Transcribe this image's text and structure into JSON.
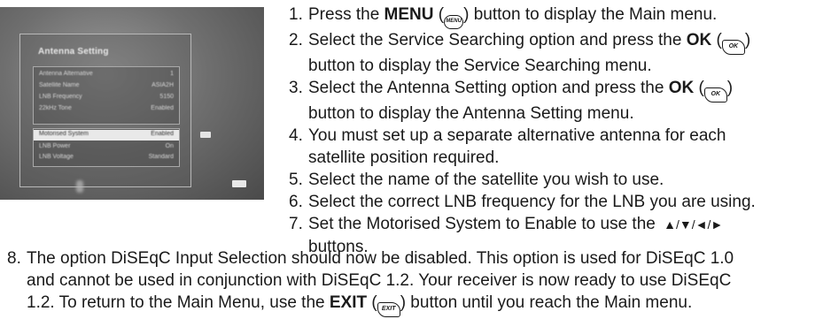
{
  "tv_screen": {
    "title": "Antenna Setting",
    "rows_top": [
      {
        "label": "Antenna Alternative",
        "value": "1"
      },
      {
        "label": "Satellite Name",
        "value": "ASIA2H"
      },
      {
        "label": "LNB Frequency",
        "value": "5150"
      },
      {
        "label": "22kHz Tone",
        "value": "Enabled"
      }
    ],
    "highlight": {
      "label": "Motorised System",
      "value": "Enabled"
    },
    "rows_bottom": [
      {
        "label": "LNB Power",
        "value": "On"
      },
      {
        "label": "LNB Voltage",
        "value": "Standard"
      }
    ],
    "icons": [
      "left-arrow-icon",
      "remote-button-icon"
    ]
  },
  "steps": [
    {
      "num": "1.",
      "pre": "Press the ",
      "bold": "MENU",
      "post_open": " (",
      "icon": "MENU",
      "post": ") button to display the Main menu."
    },
    {
      "num": "2.",
      "pre": "Select the Service Searching option and press the ",
      "bold": "OK",
      "post_open": " (",
      "icon": "OK",
      "post": ")",
      "cont": "button to display the Service Searching menu."
    },
    {
      "num": "3.",
      "pre": "Select the Antenna Setting option and press the ",
      "bold": "OK",
      "post_open": " (",
      "icon": "OK",
      "post": ")",
      "cont": "button to display the Antenna Setting menu."
    },
    {
      "num": "4.",
      "text": "You must set up a separate alternative antenna for each",
      "cont": "satellite position required."
    },
    {
      "num": "5.",
      "text": "Select the name of the satellite you wish to use."
    },
    {
      "num": "6.",
      "text": "Select the correct LNB frequency for the LNB you are using."
    },
    {
      "num": "7.",
      "text": "Set the Motorised System to Enable to use the ",
      "arrows": "▲/▼/◄/►",
      "cont": "buttons."
    }
  ],
  "step8": {
    "num": "8.",
    "line1": "The option DiSEqC Input Selection should now be disabled. This option is used for DiSEqC 1.0",
    "line2": "and cannot be used in conjunction with DiSEqC 1.2. Your receiver is now ready to use DiSEqC",
    "line3_pre": "1.2. To return to the Main Menu, use the ",
    "line3_bold": "EXIT",
    "line3_open": " (",
    "line3_icon": "EXIT",
    "line3_post": ") button until you reach the Main menu."
  }
}
